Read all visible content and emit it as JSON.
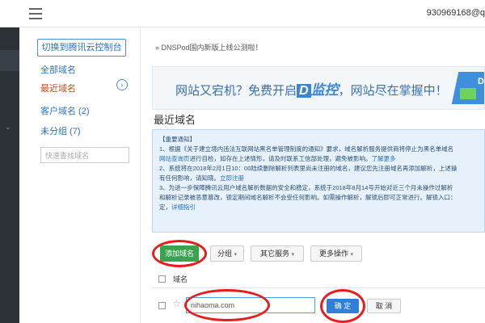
{
  "header": {
    "user_account": "930969168@q"
  },
  "sidebar": {
    "switch_button": "切换到腾讯云控制台",
    "items": [
      {
        "label": "全部域名"
      },
      {
        "label": "最近域名"
      },
      {
        "label": "客户域名 (2)"
      },
      {
        "label": "未分组 (7)"
      }
    ],
    "search_placeholder": "快速查找域名"
  },
  "main": {
    "announcement": "» DNSPod国内新版上线公测啦！",
    "banner": {
      "text_pre": "网站又宕机？免费开启",
      "brand_mark": "D",
      "brand_text": "监控",
      "text_post": "，网站尽在掌握中！",
      "corner_letter": "D"
    },
    "section_title": "最近域名",
    "notice": {
      "heading": "【重要通知】",
      "line1": "1、根据《关于建立境内违法互联网站黑名单管理制度的通知》要求，域名解析服务提供商将停止为黑名单域名",
      "line2_link": "网站查询页",
      "line2_rest": "进行自检，如存在上述情形，请及时联系工信部处理，避免被影响。",
      "line2_more": "了解更多",
      "line3": "2、系统将在2018年2月1日10：00陆续删除解析列表里尚未注册的域名，建议您先注册域名再添加解析，上述操",
      "line4_pre": "有任何影响，请知晓。",
      "line4_link": "立即注册",
      "line5": "3、为进一步保障腾讯云用户域名解析数据的安全和稳定，系统于2018年8月14号开始对近三个月未操作过解析",
      "line6": "和解析记录被恶意篡改，锁定期间域名解析不会受任何影响。如需操作解析，解锁后即可正常进行。解锁入口：",
      "line7_pre": "定，",
      "line7_link": "详细指引"
    },
    "toolbar": {
      "add_domain": "添加域名",
      "group": "分组",
      "other_services": "其它服务",
      "more_actions": "更多操作",
      "caret": "▾"
    },
    "table": {
      "column_domain": "域名"
    },
    "new_row": {
      "input_value": "nihaoma.com",
      "confirm": "确 定",
      "cancel": "取 消"
    }
  }
}
